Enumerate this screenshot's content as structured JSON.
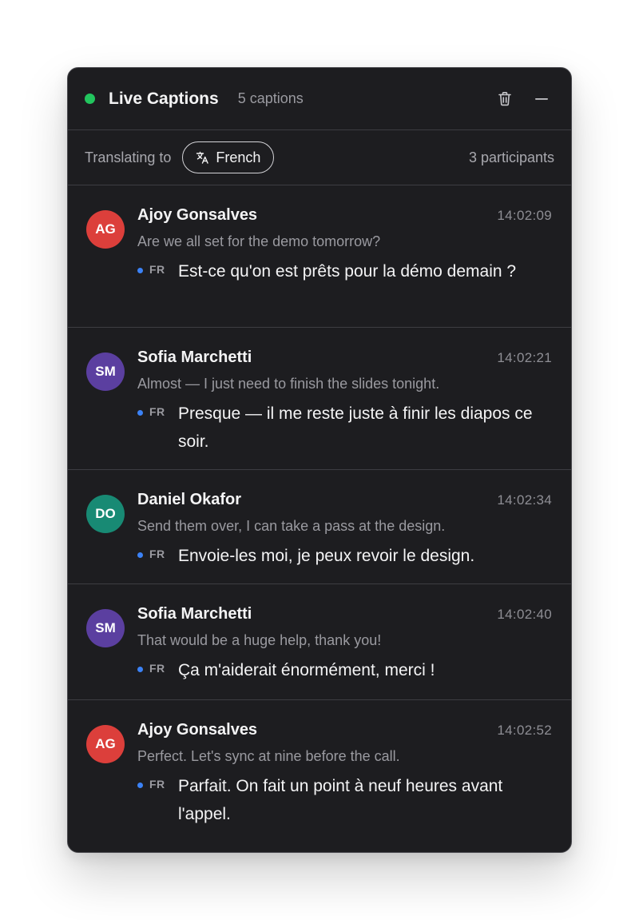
{
  "header": {
    "title": "Live Captions",
    "caption_count": "5 captions",
    "live_color": "#22c55e",
    "icons": [
      "trash-icon",
      "minimize-icon"
    ]
  },
  "subbar": {
    "label": "Translating to",
    "language": "French",
    "language_icon": "translate-icon",
    "participants": "3 participants"
  },
  "captions": [
    {
      "initials": "AG",
      "avatar_color": "#dc3f3b",
      "speaker": "Ajoy Gonsalves",
      "time": "14:02:09",
      "original": "Are we all set for the demo tomorrow?",
      "lang_code": "FR",
      "translation": "Est-ce qu'on est prêts pour la démo demain ?"
    },
    {
      "initials": "SM",
      "avatar_color": "#5b3fa0",
      "speaker": "Sofia Marchetti",
      "time": "14:02:21",
      "original": "Almost — I just need to finish the slides tonight.",
      "lang_code": "FR",
      "translation": "Presque — il me reste juste à finir les diapos ce soir."
    },
    {
      "initials": "DO",
      "avatar_color": "#188a74",
      "speaker": "Daniel Okafor",
      "time": "14:02:34",
      "original": "Send them over, I can take a pass at the design.",
      "lang_code": "FR",
      "translation": "Envoie-les moi, je peux revoir le design."
    },
    {
      "initials": "SM",
      "avatar_color": "#5b3fa0",
      "speaker": "Sofia Marchetti",
      "time": "14:02:40",
      "original": "That would be a huge help, thank you!",
      "lang_code": "FR",
      "translation": "Ça m'aiderait énormément, merci !"
    },
    {
      "initials": "AG",
      "avatar_color": "#dc3f3b",
      "speaker": "Ajoy Gonsalves",
      "time": "14:02:52",
      "original": "Perfect. Let's sync at nine before the call.",
      "lang_code": "FR",
      "translation": "Parfait. On fait un point à neuf heures avant l'appel."
    }
  ]
}
